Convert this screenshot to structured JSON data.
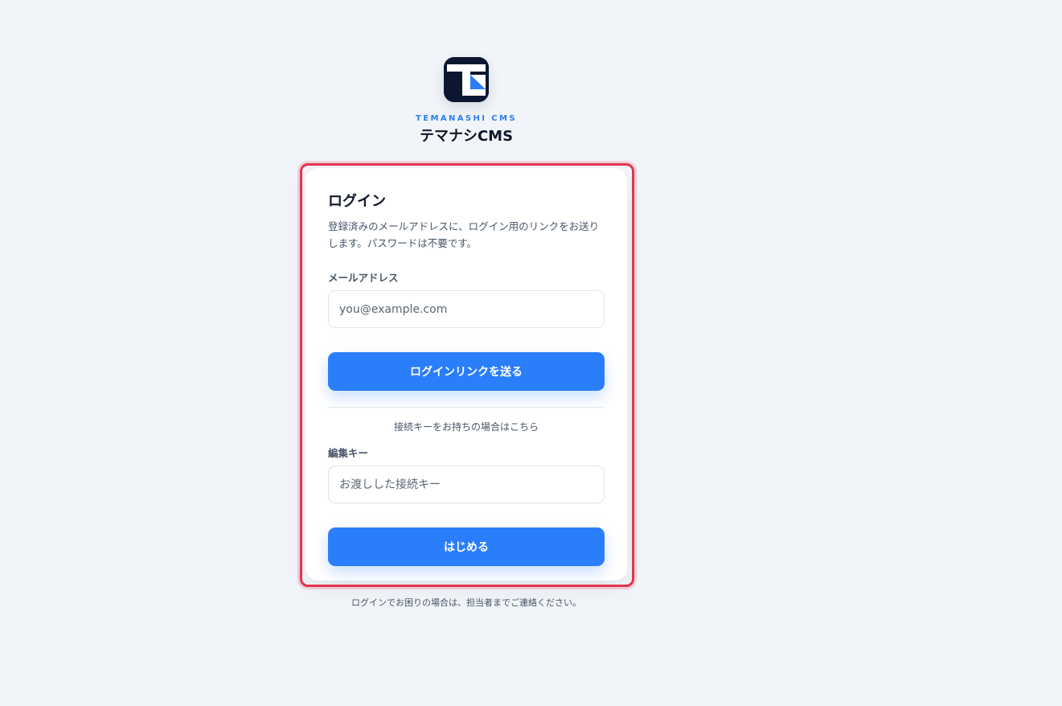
{
  "brand": {
    "logo_icon": "temanashi-logo-icon",
    "name_en": "TEMANASHI CMS",
    "name_ja": "テマナシCMS",
    "colors": {
      "navy": "#0b1630",
      "accent": "#2a7ef9"
    }
  },
  "login": {
    "title": "ログイン",
    "description": "登録済みのメールアドレスに、ログイン用のリンクをお送りします。パスワードは不要です。",
    "email_label": "メールアドレス",
    "email_placeholder": "you@example.com",
    "email_value": "",
    "send_link_button": "ログインリンクを送る",
    "alt_note": "接続キーをお持ちの場合はこちら",
    "key_label": "編集キー",
    "key_placeholder": "お渡しした接続キー",
    "key_value": "",
    "start_button": "はじめる"
  },
  "footer": {
    "help_text": "ログインでお困りの場合は、担当者までご連絡ください。"
  },
  "highlight_color": "#e3344d"
}
